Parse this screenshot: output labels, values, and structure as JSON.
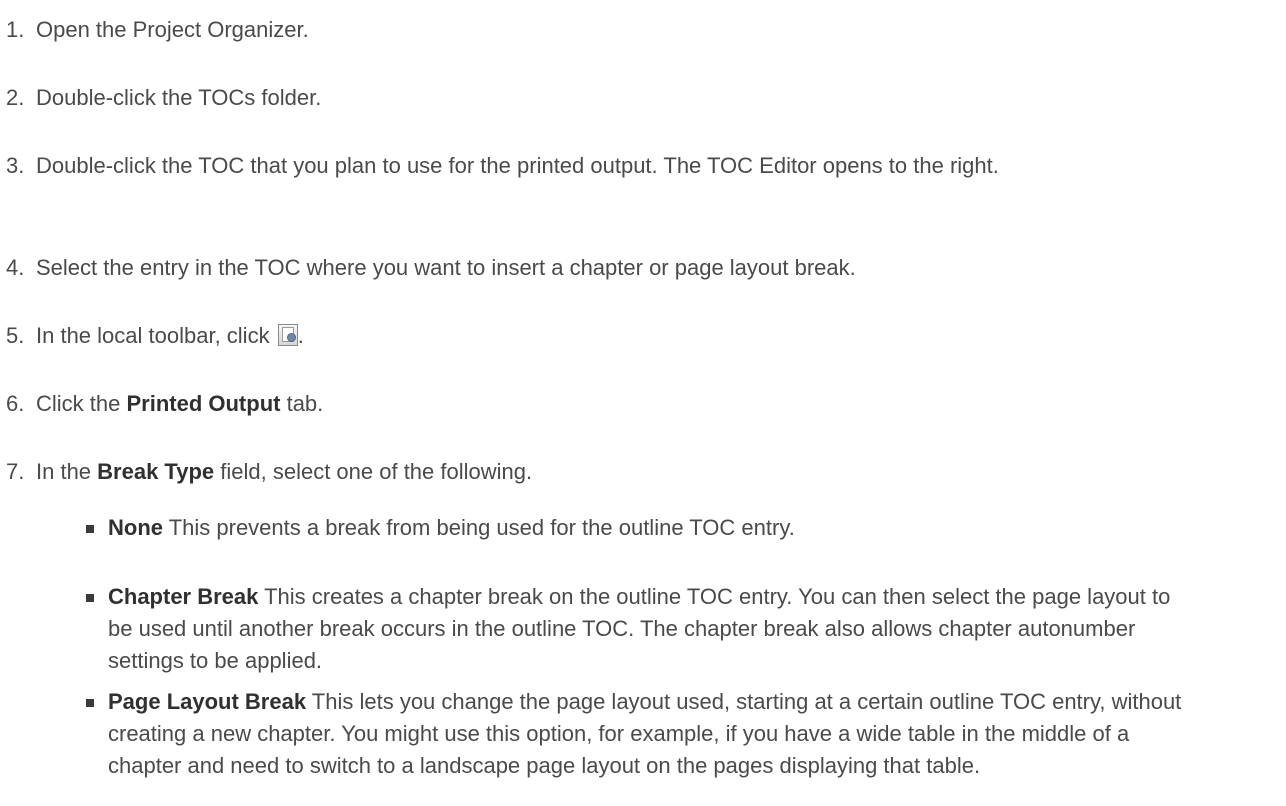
{
  "steps": [
    {
      "num": "1.",
      "text": "Open the Project Organizer."
    },
    {
      "num": "2.",
      "text": "Double-click the TOCs folder."
    },
    {
      "num": "3.",
      "text": "Double-click the TOC that you plan to use for the printed output. The TOC Editor opens to the right."
    },
    {
      "num": "4.",
      "text": "Select the entry in the TOC where you want to insert a chapter or page layout break."
    },
    {
      "num": "5.",
      "text_before": "In the local toolbar, click ",
      "text_after": ".",
      "icon": "toc-properties-icon"
    },
    {
      "num": "6.",
      "text_before": "Click the ",
      "bold": "Printed Output",
      "text_after": " tab."
    },
    {
      "num": "7.",
      "text_before": "In the ",
      "bold": "Break Type",
      "text_after": " field, select one of the following."
    }
  ],
  "options": [
    {
      "bold": "None",
      "text": " This prevents a break from being used for the outline TOC entry."
    },
    {
      "bold": "Chapter Break",
      "text": " This creates a chapter break on the outline TOC entry. You can then select the page layout to be used until another break occurs in the outline TOC. The chapter break also allows chapter autonumber settings to be applied."
    },
    {
      "bold": "Page Layout Break",
      "text": " This lets you change the page layout used, starting at a certain outline TOC entry, without creating a new chapter. You might use this option, for example, if you have a wide table in the middle of a chapter and need to switch to a landscape page layout on the pages displaying that table."
    }
  ]
}
